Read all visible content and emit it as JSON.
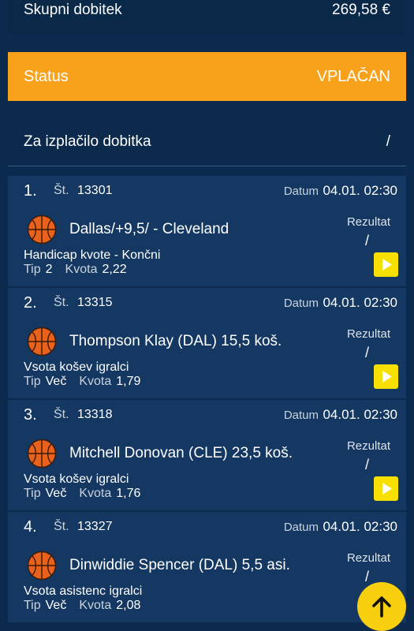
{
  "summary": {
    "total_label": "Skupni dobitek",
    "total_value": "269,58 €",
    "status_label": "Status",
    "status_value": "VPLAČAN",
    "payout_label": "Za izplačilo dobitka",
    "payout_value": "/"
  },
  "labels": {
    "st": "Št.",
    "datum": "Datum",
    "rezultat": "Rezultat",
    "tip": "Tip",
    "kvota": "Kvota"
  },
  "bets": [
    {
      "index": "1.",
      "number": "13301",
      "date": "04.01. 02:30",
      "event": "Dallas/+9,5/ - Cleveland",
      "market": "Handicap kvote - Končni",
      "result": "/",
      "tip": "2",
      "odds": "2,22",
      "icon": "basketball-icon"
    },
    {
      "index": "2.",
      "number": "13315",
      "date": "04.01. 02:30",
      "event": "Thompson Klay (DAL) 15,5 koš.",
      "market": "Vsota košev igralci",
      "result": "/",
      "tip": "Več",
      "odds": "1,79",
      "icon": "basketball-icon"
    },
    {
      "index": "3.",
      "number": "13318",
      "date": "04.01. 02:30",
      "event": "Mitchell Donovan (CLE) 23,5 koš.",
      "market": "Vsota košev igralci",
      "result": "/",
      "tip": "Več",
      "odds": "1,76",
      "icon": "basketball-icon"
    },
    {
      "index": "4.",
      "number": "13327",
      "date": "04.01. 02:30",
      "event": "Dinwiddie Spencer (DAL) 5,5 asi.",
      "market": "Vsota asistenc igralci",
      "result": "/",
      "tip": "Več",
      "odds": "2,08",
      "icon": "basketball-icon"
    }
  ],
  "colors": {
    "background": "#0b2a4e",
    "card": "#143862",
    "status_bar": "#f8a21c",
    "play_button": "#f7e000",
    "scroll_top_button": "#f7cf0e"
  }
}
